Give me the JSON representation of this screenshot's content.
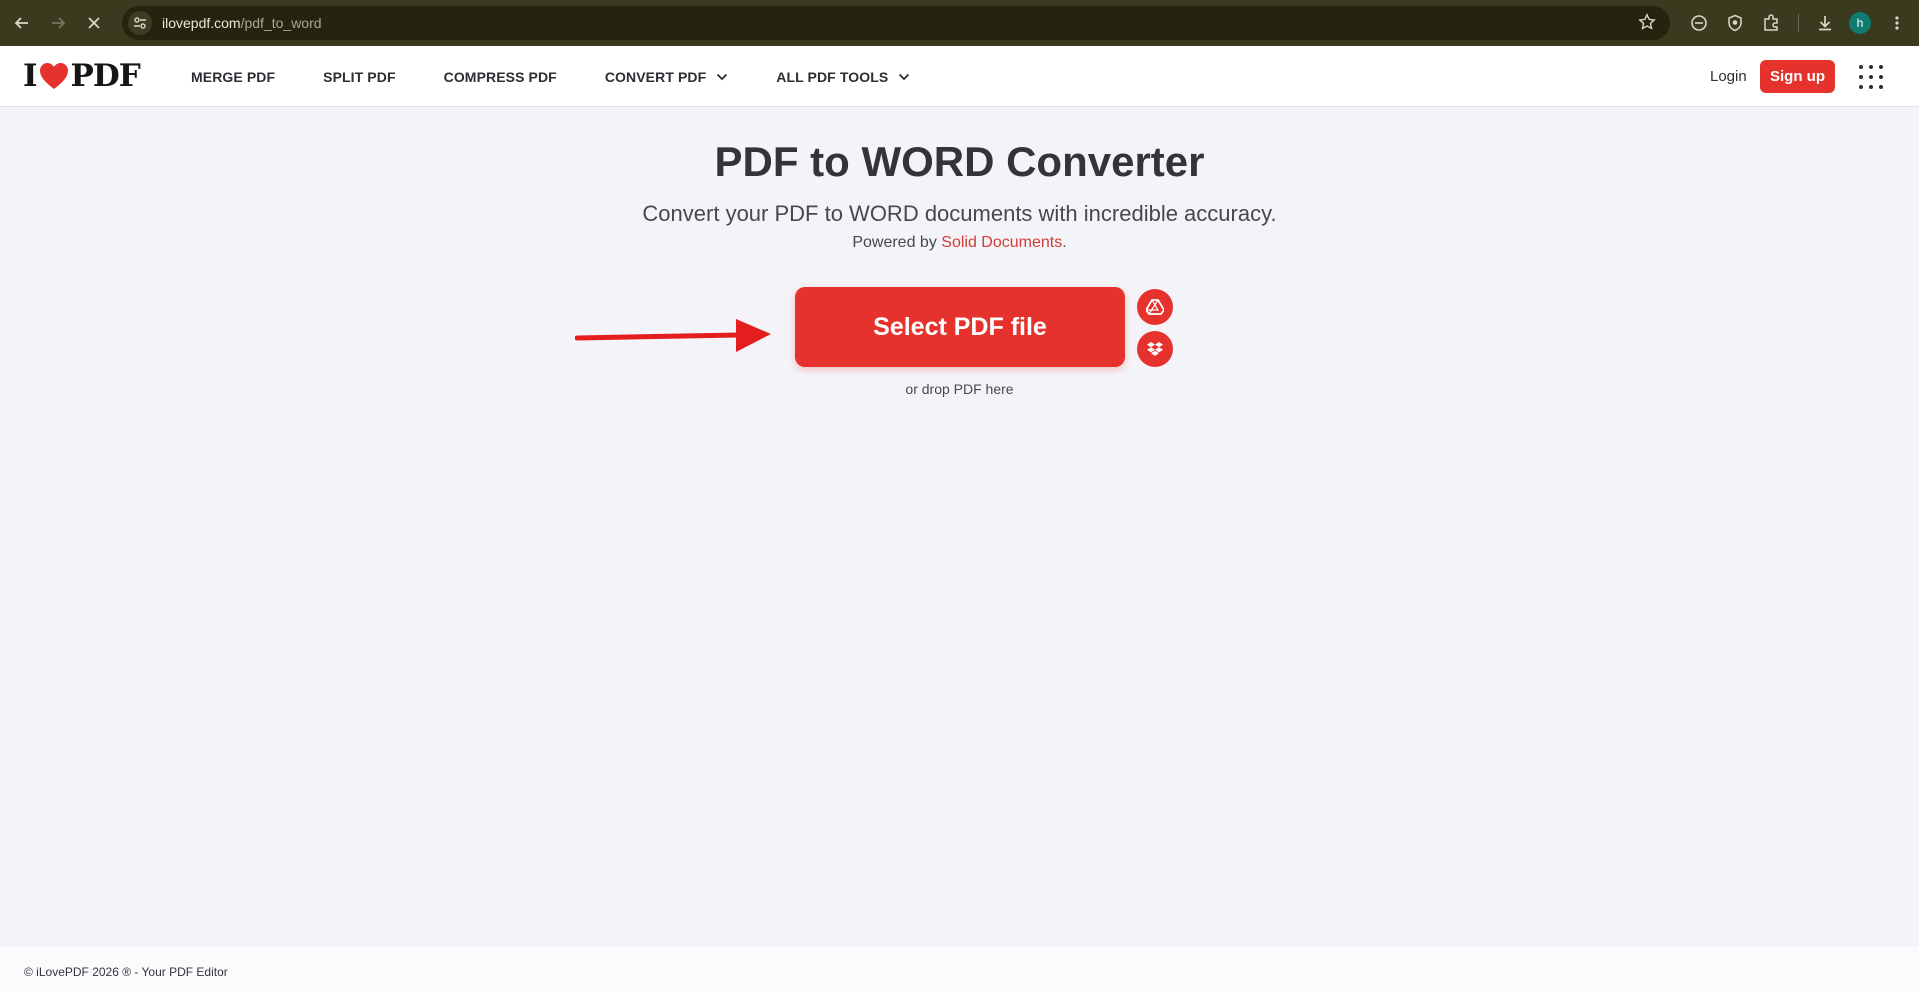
{
  "browser": {
    "url_host": "ilovepdf.com",
    "url_path": "/pdf_to_word",
    "profile_initial": "h"
  },
  "site": {
    "logo_left": "I",
    "logo_right": "PDF",
    "nav": [
      {
        "label": "MERGE PDF"
      },
      {
        "label": "SPLIT PDF"
      },
      {
        "label": "COMPRESS PDF"
      },
      {
        "label": "CONVERT PDF"
      },
      {
        "label": "ALL PDF TOOLS"
      }
    ],
    "login_label": "Login",
    "signup_label": "Sign up"
  },
  "main": {
    "title": "PDF to WORD Converter",
    "subtitle": "Convert your PDF to WORD documents with incredible accuracy.",
    "powered_prefix": "Powered by ",
    "powered_link": "Solid Documents",
    "powered_suffix": ".",
    "select_label": "Select PDF file",
    "drop_hint": "or drop PDF here"
  },
  "footer": {
    "copyright": "© iLovePDF 2026 ® - Your PDF Editor"
  },
  "colors": {
    "brand_red": "#e5322d",
    "chrome_bg": "#3a3a1e",
    "page_bg": "#f4f4f8"
  },
  "icons": [
    "back-arrow-icon",
    "forward-arrow-icon",
    "stop-loading-icon",
    "site-settings-icon",
    "bookmark-star-icon",
    "extension-icon",
    "downloads-icon",
    "more-vert-icon",
    "heart-icon",
    "chevron-down-icon",
    "apps-grid-icon",
    "google-drive-icon",
    "dropbox-icon",
    "annotation-arrow"
  ]
}
